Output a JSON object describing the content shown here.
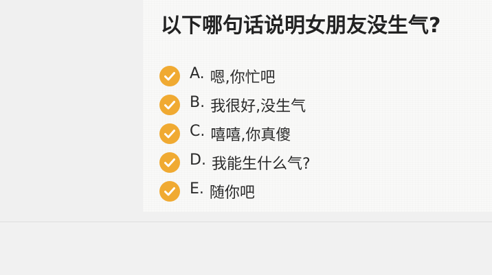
{
  "question": {
    "title": "以下哪句话说明女朋友没生气?"
  },
  "options": [
    {
      "letter": "A.",
      "text": "嗯,你忙吧"
    },
    {
      "letter": "B.",
      "text": "我很好,没生气"
    },
    {
      "letter": "C.",
      "text": "嘻嘻,你真傻"
    },
    {
      "letter": "D.",
      "text": "我能生什么气?"
    },
    {
      "letter": "E.",
      "text": "随你吧"
    }
  ],
  "colors": {
    "check_fill": "#f0aa32",
    "check_mark": "#ffffff",
    "text": "#2a2a2a"
  },
  "icons": {
    "option_marker": "check-circle-icon"
  }
}
